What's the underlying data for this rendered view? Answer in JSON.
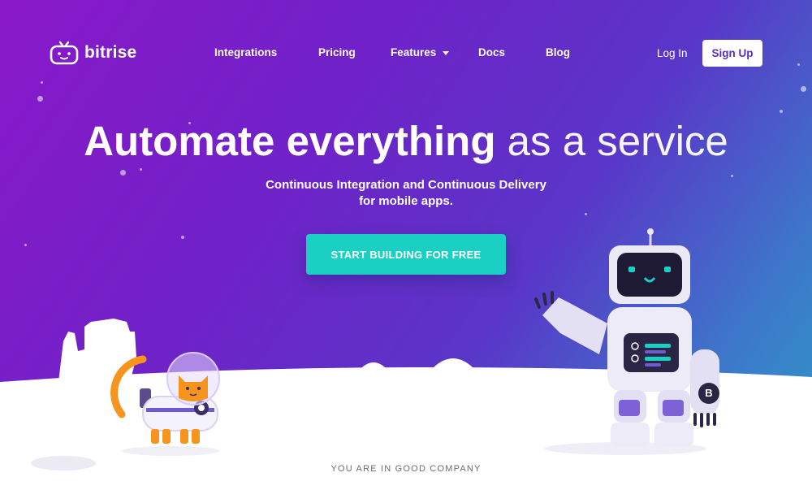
{
  "brand": {
    "name": "bitrise",
    "logo_icon": "robot-face-icon"
  },
  "nav": {
    "items": [
      {
        "label": "Integrations"
      },
      {
        "label": "Pricing"
      },
      {
        "label": "Features",
        "has_dropdown": true
      },
      {
        "label": "Docs"
      },
      {
        "label": "Blog"
      }
    ],
    "login": "Log In",
    "signup": "Sign Up"
  },
  "hero": {
    "headline_strong": "Automate everything",
    "headline_light": "as a service",
    "subtitle_line1": "Continuous Integration and Continuous Delivery",
    "subtitle_line2": "for mobile apps.",
    "cta": "START BUILDING FOR FREE"
  },
  "robot": {
    "chest_badge": "B"
  },
  "footer_teaser": "YOU ARE IN GOOD COMPANY",
  "colors": {
    "gradient_start": "#8a18c9",
    "gradient_end": "#2d9ac8",
    "cta": "#1ad0c2",
    "signup_text": "#5b2bc6"
  }
}
